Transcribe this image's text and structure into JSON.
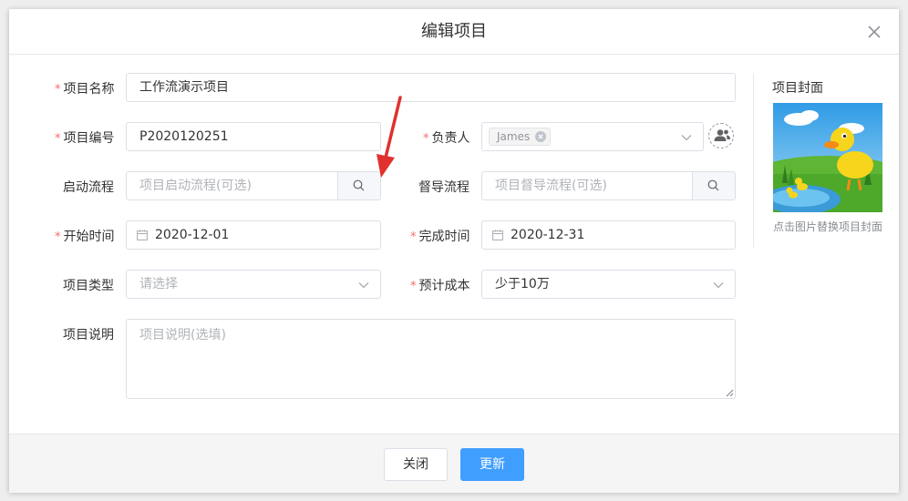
{
  "dialog": {
    "title": "编辑项目"
  },
  "form": {
    "project_name": {
      "label": "项目名称",
      "value": "工作流演示项目",
      "required": "*"
    },
    "project_code": {
      "label": "项目编号",
      "value": "P2020120251",
      "required": "*"
    },
    "owner": {
      "label": "负责人",
      "tag": "James",
      "required": "*"
    },
    "start_flow": {
      "label": "启动流程",
      "placeholder": "项目启动流程(可选)"
    },
    "supervise_flow": {
      "label": "督导流程",
      "placeholder": "项目督导流程(可选)"
    },
    "start_date": {
      "label": "开始时间",
      "value": "2020-12-01",
      "required": "*"
    },
    "end_date": {
      "label": "完成时间",
      "value": "2020-12-31",
      "required": "*"
    },
    "project_type": {
      "label": "项目类型",
      "placeholder": "请选择"
    },
    "estimated_cost": {
      "label": "预计成本",
      "value": "少于10万",
      "required": "*"
    },
    "description": {
      "label": "项目说明",
      "placeholder": "项目说明(选填)"
    }
  },
  "cover": {
    "title": "项目封面",
    "hint": "点击图片替换项目封面"
  },
  "footer": {
    "close_label": "关闭",
    "update_label": "更新"
  },
  "colors": {
    "primary": "#409eff",
    "required": "#f56c6c",
    "annotation": "#e0312e"
  },
  "icons": {
    "close": "close-icon",
    "search": "search-icon",
    "calendar": "calendar-icon",
    "chevron": "chevron-down-icon",
    "add_user": "add-user-icon"
  }
}
